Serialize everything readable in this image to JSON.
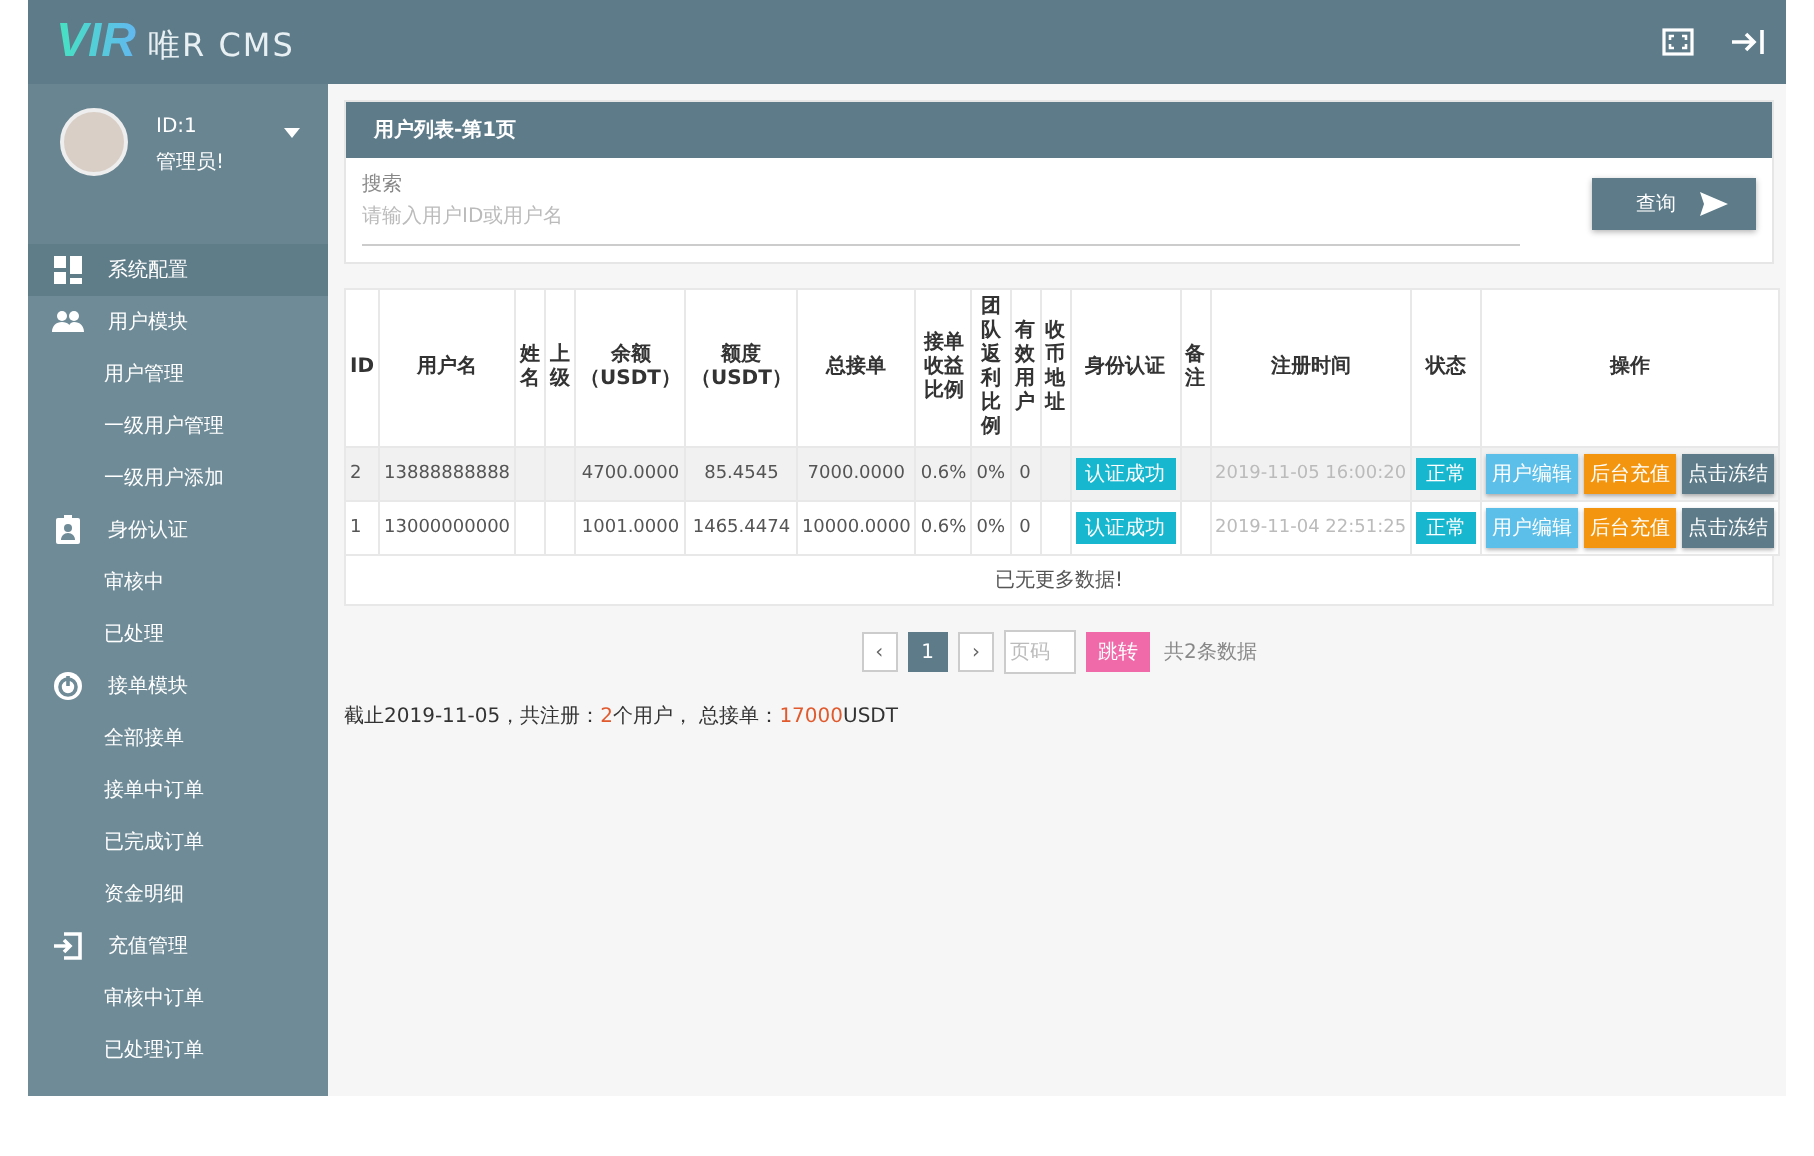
{
  "header": {
    "logo_mark": "VIR",
    "logo_text": "唯R CMS"
  },
  "user": {
    "id": "ID:1",
    "role": "管理员!"
  },
  "menu": [
    {
      "label": "系统配置",
      "selected": true
    },
    {
      "label": "用户模块",
      "selected": false,
      "children": [
        {
          "label": "用户管理",
          "selected": false
        },
        {
          "label": "一级用户管理",
          "selected": false
        },
        {
          "label": "一级用户添加",
          "selected": false
        }
      ]
    },
    {
      "label": "身份认证",
      "selected": false,
      "children": [
        {
          "label": "审核中",
          "selected": false
        },
        {
          "label": "已处理",
          "selected": false
        }
      ]
    },
    {
      "label": "接单模块",
      "selected": false,
      "children": [
        {
          "label": "全部接单",
          "selected": false
        },
        {
          "label": "接单中订单",
          "selected": false
        },
        {
          "label": "已完成订单",
          "selected": false
        },
        {
          "label": "资金明细",
          "selected": false
        }
      ]
    },
    {
      "label": "充值管理",
      "selected": false,
      "children": [
        {
          "label": "审核中订单",
          "selected": false
        },
        {
          "label": "已处理订单",
          "selected": false
        }
      ]
    }
  ],
  "panel": {
    "title": "用户列表-第1页",
    "search_label": "搜索",
    "placeholder": "请输入用户ID或用户名",
    "button": "查询"
  },
  "table": {
    "columns": [
      "ID",
      "用户名",
      "姓名",
      "上级",
      "余额（USDT）",
      "额度（USDT）",
      "总接单",
      "接单收益比例",
      "团队返利比例",
      "有效用户",
      "收币地址",
      "身份认证",
      "备注",
      "注册时间",
      "状态",
      "操作"
    ],
    "rows": [
      {
        "id": "2",
        "username": "13888888888",
        "balance": "4700.0000",
        "quota": "85.4545",
        "orders": "7000.0000",
        "order_rate": "0.6%",
        "team_rate": "0%",
        "valid_users": "0",
        "verification": "认证成功",
        "registered": "2019-11-05 16:00:20",
        "status": "正常",
        "shaded": true,
        "actions": [
          {
            "kind": "edit",
            "label": "用户编辑"
          },
          {
            "kind": "recharge",
            "label": "后台充值"
          },
          {
            "kind": "freeze",
            "label": "点击冻结"
          }
        ]
      },
      {
        "id": "1",
        "username": "13000000000",
        "balance": "1001.0000",
        "quota": "1465.4474",
        "orders": "10000.0000",
        "order_rate": "0.6%",
        "team_rate": "0%",
        "valid_users": "0",
        "verification": "认证成功",
        "registered": "2019-11-04 22:51:25",
        "status": "正常",
        "shaded": false,
        "actions": [
          {
            "kind": "edit",
            "label": "用户编辑"
          },
          {
            "kind": "recharge",
            "label": "后台充值"
          },
          {
            "kind": "freeze",
            "label": "点击冻结"
          }
        ]
      }
    ],
    "footer": "已无更多数据!"
  },
  "pager": {
    "prev": "‹",
    "pages": [
      {
        "label": "1",
        "selected": true
      }
    ],
    "next": "›",
    "page_placeholder": "页码",
    "jump": "跳转",
    "total": "共2条数据"
  },
  "summary": [
    {
      "text": "截止2019-11-05，共注册：",
      "highlight": false
    },
    {
      "text": "2",
      "highlight": true
    },
    {
      "text": "个用户， 总接单：",
      "highlight": false
    },
    {
      "text": "17000",
      "highlight": true
    },
    {
      "text": "USDT",
      "highlight": false
    }
  ]
}
